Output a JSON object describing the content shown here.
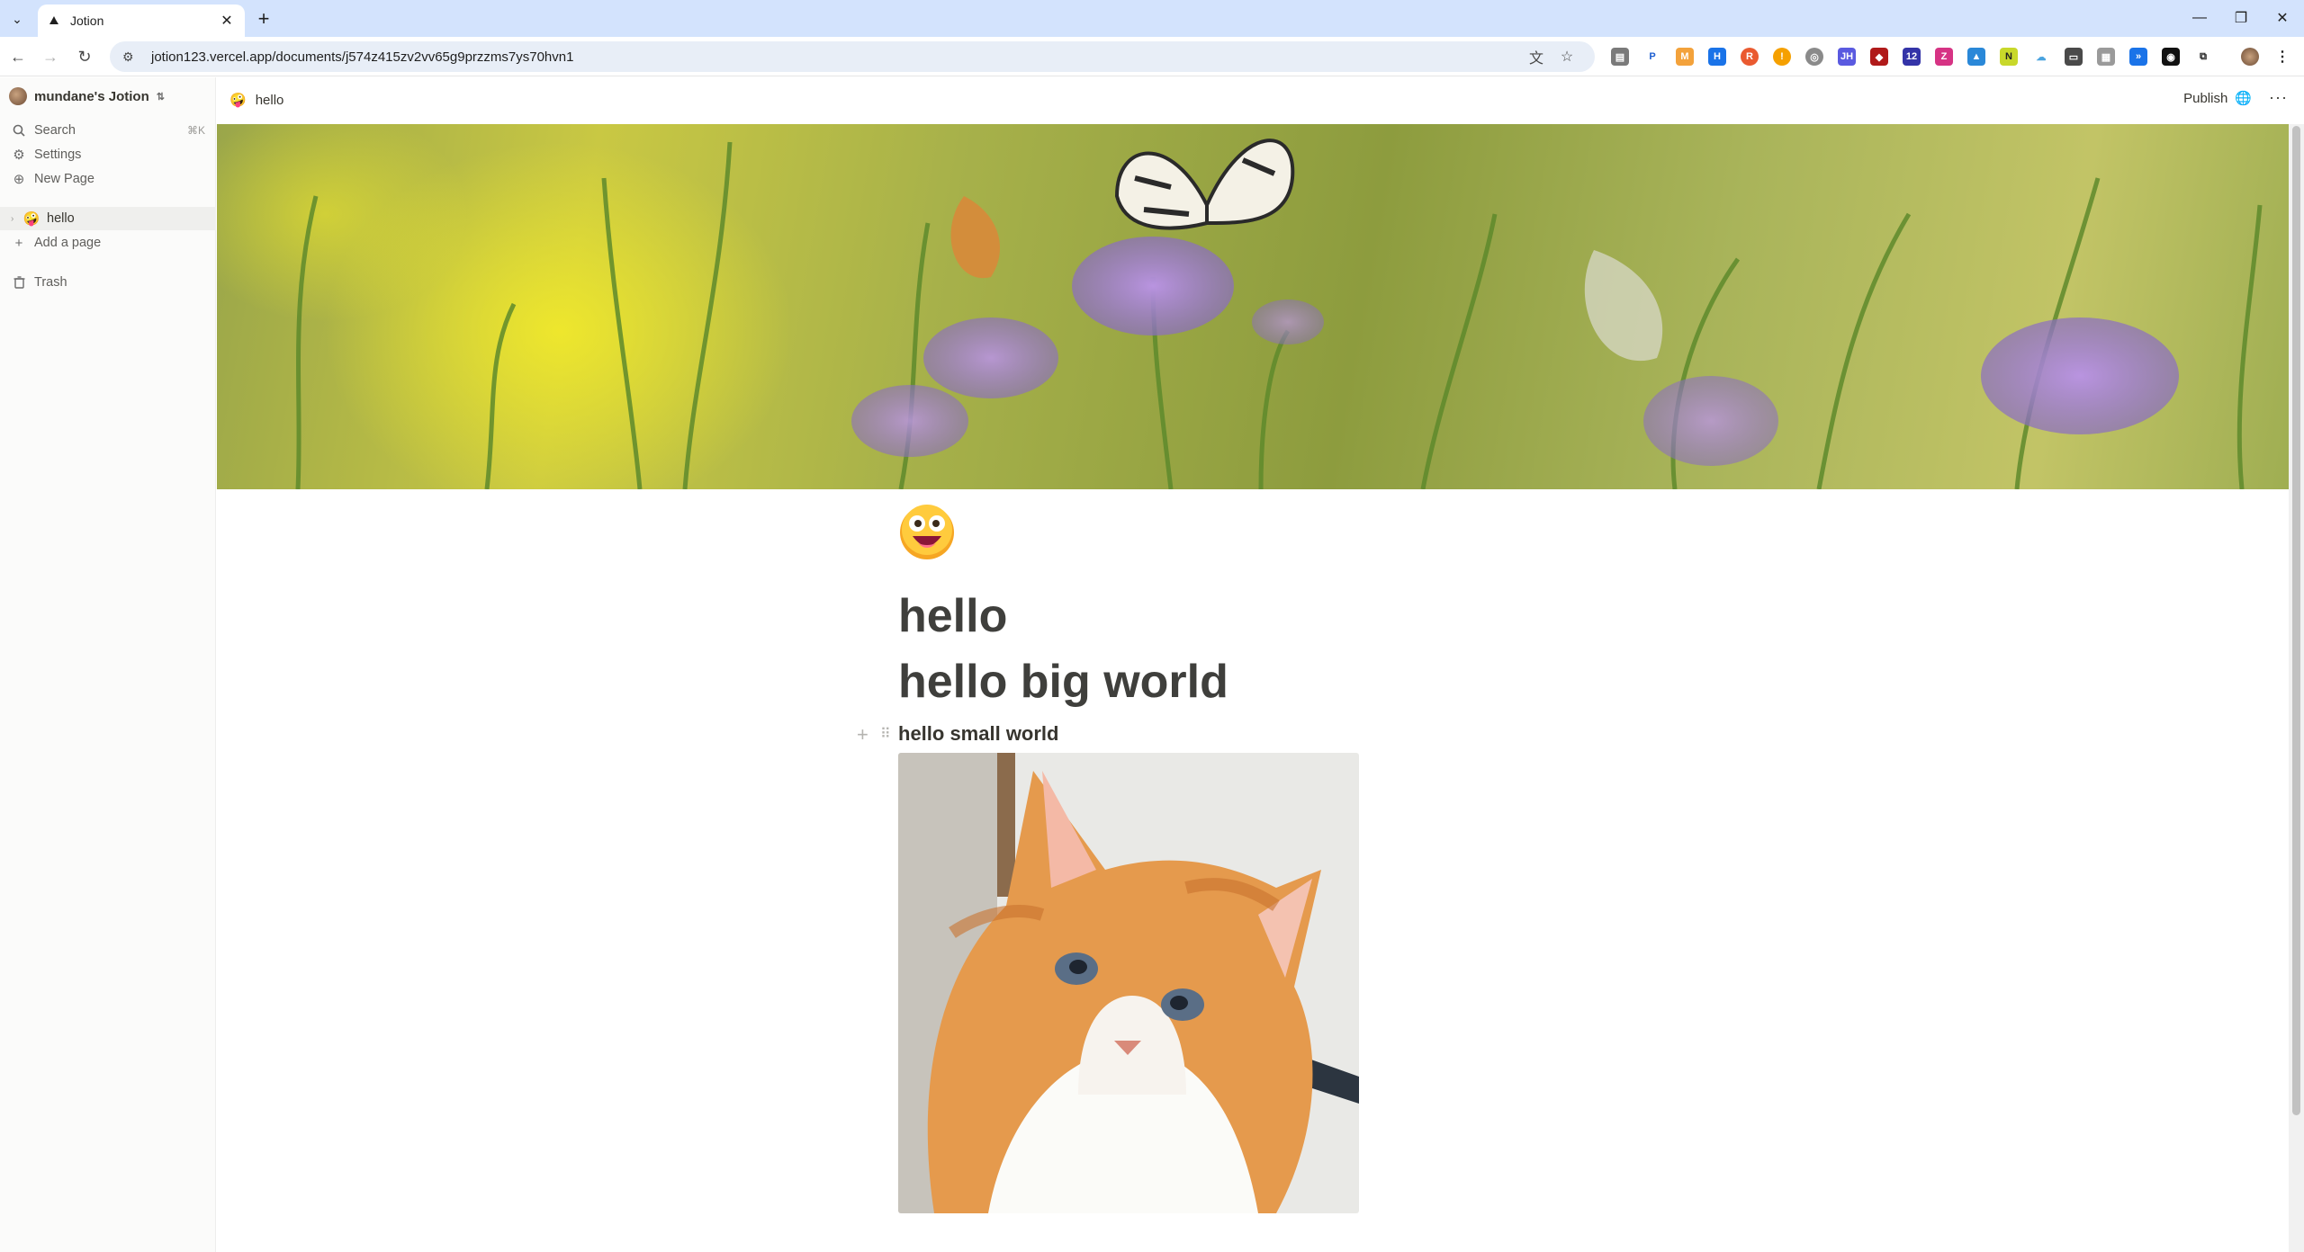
{
  "browser": {
    "tab_title": "Jotion",
    "url": "jotion123.vercel.app/documents/j574z415zv2vv65g9przzms7ys70hvn1"
  },
  "sidebar": {
    "workspace_name": "mundane's Jotion",
    "search_label": "Search",
    "search_shortcut": "⌘K",
    "settings_label": "Settings",
    "new_page_label": "New Page",
    "pages": [
      {
        "emoji": "🤪",
        "label": "hello"
      }
    ],
    "add_page_label": "Add a page",
    "trash_label": "Trash"
  },
  "topbar": {
    "breadcrumb_emoji": "🤪",
    "breadcrumb_title": "hello",
    "publish_label": "Publish",
    "more_label": "···"
  },
  "document": {
    "title": "hello",
    "heading1": "hello big world",
    "heading3": "hello small world"
  },
  "colors": {
    "sidebar_bg": "#fbfbfa",
    "tabstrip_bg": "#d3e3fd",
    "accent": "#2383e2",
    "text": "#37352f"
  }
}
